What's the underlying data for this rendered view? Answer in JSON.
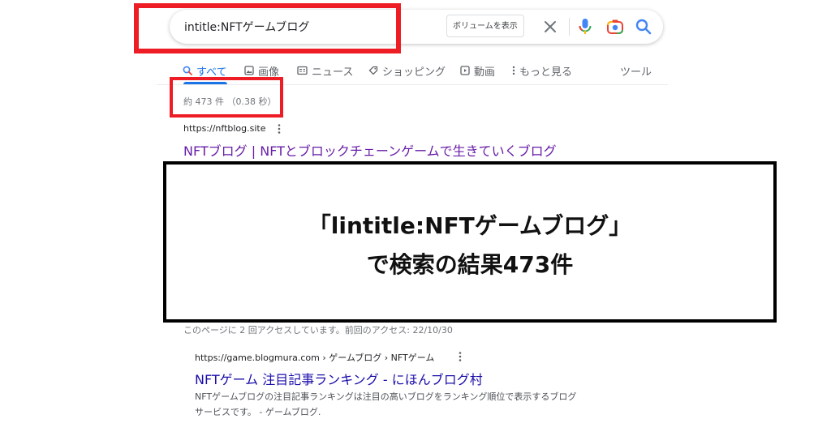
{
  "search": {
    "query": "intitle:NFTゲームブログ",
    "volume_button_label": "ボリュームを表示"
  },
  "tabs": [
    {
      "label": "すべて",
      "icon": "search-icon",
      "active": true
    },
    {
      "label": "画像",
      "icon": "image-icon"
    },
    {
      "label": "ニュース",
      "icon": "news-icon"
    },
    {
      "label": "ショッピング",
      "icon": "tag-icon"
    },
    {
      "label": "動画",
      "icon": "video-icon"
    },
    {
      "label": "もっと見る",
      "icon": "more-vert-icon"
    }
  ],
  "tools_label": "ツール",
  "result_stats": "約 473 件 （0.38 秒）",
  "results": [
    {
      "url": "https://nftblog.site",
      "title": "NFTブログ | NFTとブロックチェーンゲームで生きていくブログ",
      "visit_note": "このページに 2 回アクセスしています。前回のアクセス: 22/10/30"
    },
    {
      "url": "https://game.blogmura.com › ゲームブログ › NFTゲーム",
      "title": "NFTゲーム 注目記事ランキング - にほんブログ村",
      "snippet_line_1": "NFTゲームブログの注目記事ランキングは注目の高いブログをランキング順位で表示するブログ",
      "snippet_line_2": "サービスです。 - ゲームブログ."
    }
  ],
  "caption": {
    "line1": "「lintitle:NFTゲームブログ」",
    "line2": "で検索の結果473件"
  },
  "colors": {
    "highlight": "#ee1c24",
    "link_visited": "#681da8",
    "link": "#1a0dab",
    "accent": "#1a73e8"
  }
}
